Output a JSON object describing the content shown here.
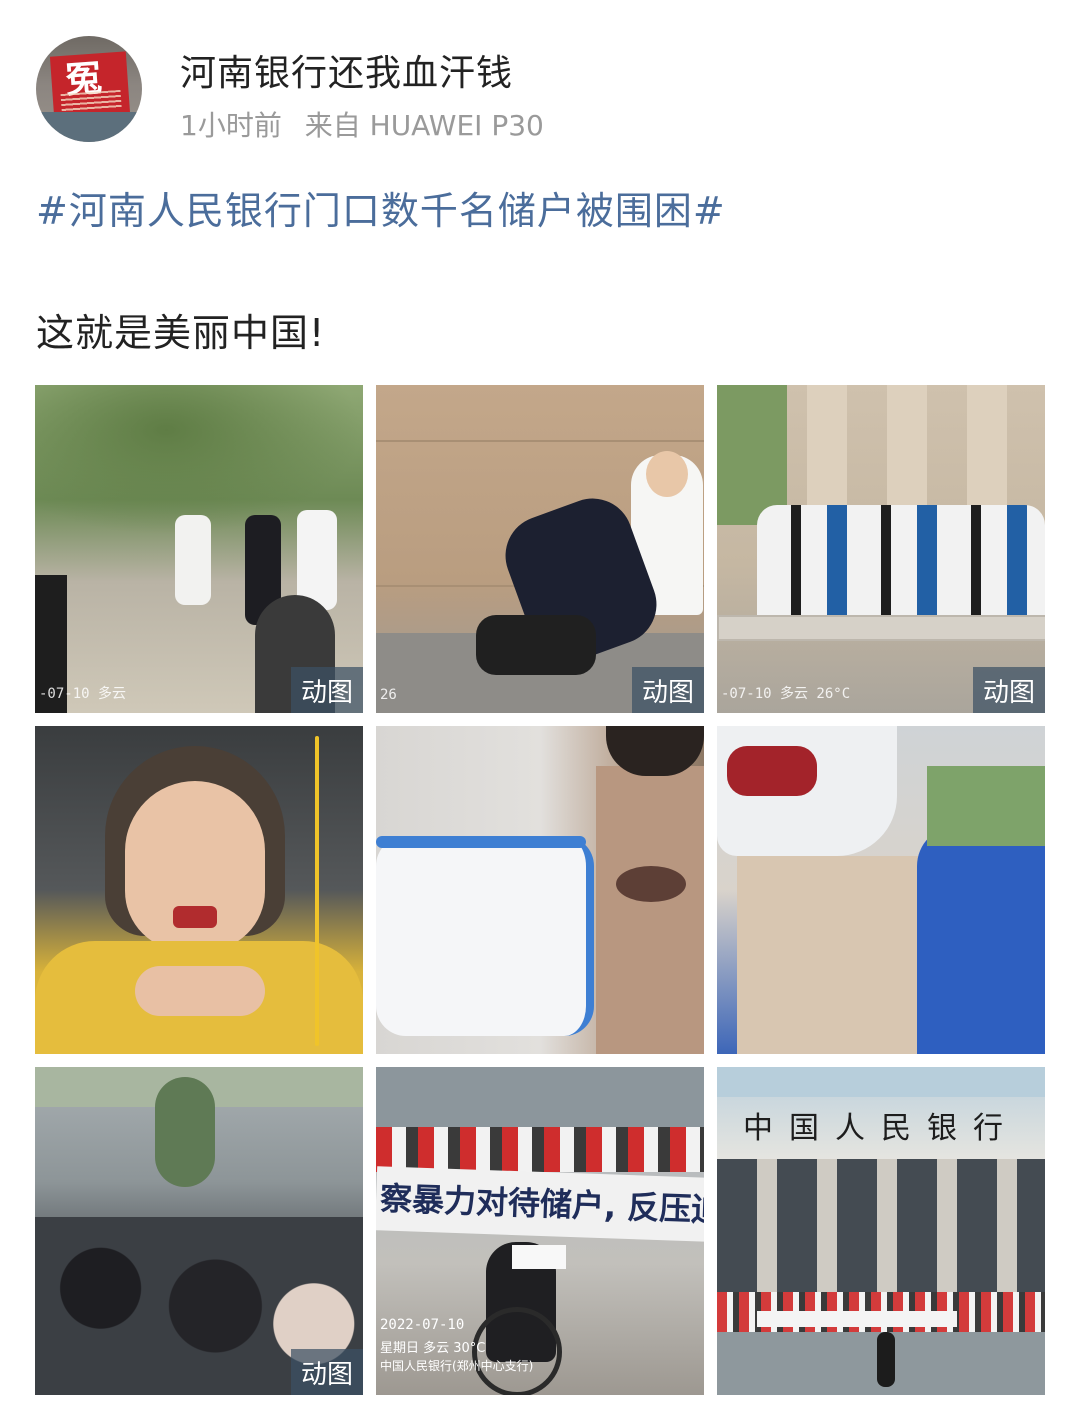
{
  "post": {
    "user_name": "河南银行还我血汗钱",
    "time": "1小时前",
    "source": "来自 HUAWEI P30",
    "hashtag": "#河南人民银行门口数千名储户被围困#",
    "text": "这就是美丽中国!",
    "avatar_char": "冤"
  },
  "images": [
    {
      "name": "image-1-scuffle-under-trees",
      "gif_label": "动图",
      "overlay_text": "-07-10 多云"
    },
    {
      "name": "image-2-person-pushed-down",
      "gif_label": "动图",
      "overlay_text": "26"
    },
    {
      "name": "image-3-crowd-at-pillars",
      "gif_label": "动图",
      "overlay_text": "-07-10 多云 26°C"
    },
    {
      "name": "image-4-injured-woman-bleeding-mouth",
      "gif_label": "",
      "overlay_text": ""
    },
    {
      "name": "image-5-bruised-eye-closeup",
      "gif_label": "",
      "overlay_text": ""
    },
    {
      "name": "image-6-bloody-mask",
      "gif_label": "",
      "overlay_text": ""
    },
    {
      "name": "image-7-seated-crowd",
      "gif_label": "动图",
      "overlay_text": ""
    },
    {
      "name": "image-8-protest-banner-wheelchair",
      "gif_label": "",
      "overlay_text": "察暴力对待储户, 反压迫,",
      "stamp": "2022-07-10",
      "stamp2": "星期日 多云 30°C",
      "stamp3": "中国人民银行(郑州中心支行)"
    },
    {
      "name": "image-9-bank-facade-crowd",
      "gif_label": "",
      "overlay_text": "中国人民银行"
    }
  ],
  "colors": {
    "hashtag": "#4b6d9b",
    "username": "#222222",
    "meta": "#9a9a9a"
  },
  "icons": {
    "avatar": "avatar-image"
  }
}
